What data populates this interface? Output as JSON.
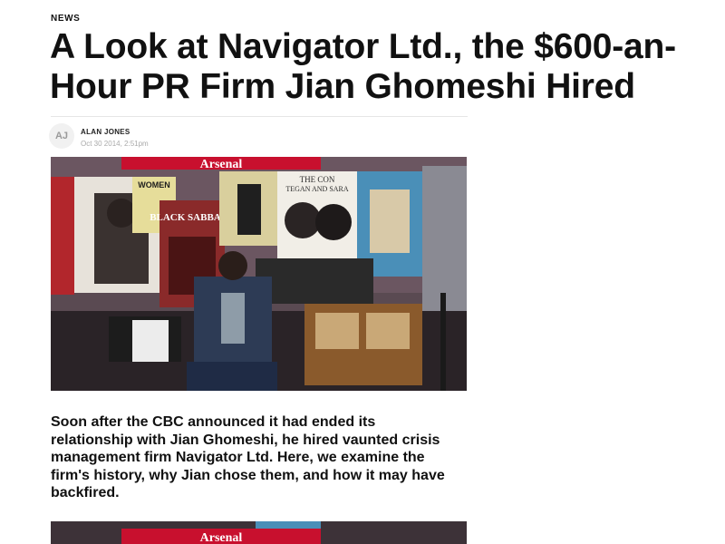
{
  "article": {
    "section": "NEWS",
    "headline": "A Look at Navigator Ltd., the $600-an-Hour PR Firm Jian Ghomeshi Hired",
    "author": {
      "initials": "AJ",
      "name": "ALAN JONES",
      "timestamp": "Oct 30 2014, 2:51pm"
    },
    "hero_image": {
      "banner_text": "Arsenal",
      "posters": {
        "women": "WOMEN",
        "black_sabbath": "BLACK SABBATH",
        "con": "THE CON",
        "tegan_sara": "TEGAN AND SARA"
      }
    },
    "summary": "Soon after the CBC announced it had ended its relationship with Jian Ghomeshi, he hired vaunted crisis management firm Navigator Ltd. Here, we examine the firm's history, why Jian chose them, and how it may have backfired.",
    "second_image": {
      "banner_text": "Arsenal"
    }
  },
  "colors": {
    "text": "#111111",
    "muted": "#a9a9a9",
    "banner_red": "#c8102e"
  }
}
